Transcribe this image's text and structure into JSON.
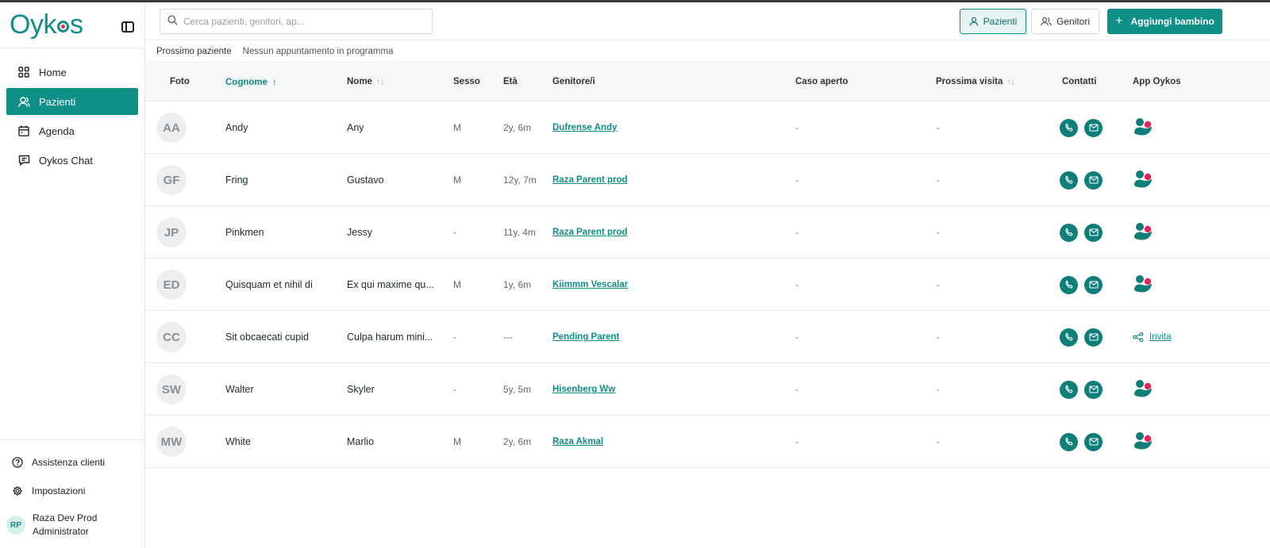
{
  "app": {
    "logo_pre": "Oyk",
    "logo_post": "s"
  },
  "sidebar": {
    "items": [
      {
        "label": "Home",
        "icon": "grid-icon"
      },
      {
        "label": "Pazienti",
        "icon": "user-icon",
        "active": true
      },
      {
        "label": "Agenda",
        "icon": "calendar-icon"
      },
      {
        "label": "Oykos Chat",
        "icon": "chat-icon"
      }
    ],
    "bottom": [
      {
        "label": "Assistenza clienti",
        "icon": "help-icon"
      },
      {
        "label": "Impostazioni",
        "icon": "gear-icon"
      }
    ],
    "user": {
      "initials": "RP",
      "name": "Raza Dev Prod",
      "role": "Administrator"
    }
  },
  "header": {
    "search_placeholder": "Cerca pazienti, genitori, ap...",
    "btn_pazienti": "Pazienti",
    "btn_genitori": "Genitori",
    "btn_add": "Aggiungi bambino"
  },
  "subbar": {
    "label": "Prossimo paziente",
    "value": "Nessun appuntamento in programma"
  },
  "table": {
    "columns": {
      "foto": "Foto",
      "cognome": "Cognome",
      "nome": "Nome",
      "sesso": "Sesso",
      "eta": "Età",
      "genitori": "Genitore/i",
      "caso": "Caso aperto",
      "visita": "Prossima visita",
      "contatti": "Contatti",
      "app": "App Oykos"
    },
    "rows": [
      {
        "initials": "AA",
        "cognome": "Andy",
        "nome": "Any",
        "sesso": "M",
        "eta": "2y, 6m",
        "genitore": "Dufrense Andy",
        "caso": "-",
        "visita": "-",
        "app": "oykos-app-icon"
      },
      {
        "initials": "GF",
        "cognome": "Fring",
        "nome": "Gustavo",
        "sesso": "M",
        "eta": "12y, 7m",
        "genitore": "Raza Parent prod",
        "caso": "-",
        "visita": "-",
        "app": "oykos-app-icon"
      },
      {
        "initials": "JP",
        "cognome": "Pinkmen",
        "nome": "Jessy",
        "sesso": "-",
        "eta": "11y, 4m",
        "genitore": "Raza Parent prod",
        "caso": "-",
        "visita": "-",
        "app": "oykos-app-icon"
      },
      {
        "initials": "ED",
        "cognome": "Quisquam et nihil di",
        "nome": "Ex qui maxime qu...",
        "sesso": "M",
        "eta": "1y, 6m",
        "genitore": "Kiimmm Vescalar",
        "caso": "-",
        "visita": "-",
        "app": "oykos-app-icon"
      },
      {
        "initials": "CC",
        "cognome": "Sit obcaecati cupid",
        "nome": "Culpa harum mini...",
        "sesso": "-",
        "eta": "---",
        "genitore": "Pending Parent",
        "caso": "-",
        "visita": "-",
        "app": "invite",
        "invite_label": "Invita"
      },
      {
        "initials": "SW",
        "cognome": "Walter",
        "nome": "Skyler",
        "sesso": "-",
        "eta": "5y, 5m",
        "genitore": "Hisenberg Ww",
        "caso": "-",
        "visita": "-",
        "app": "oykos-app-icon"
      },
      {
        "initials": "MW",
        "cognome": "White",
        "nome": "Marlio",
        "sesso": "M",
        "eta": "2y, 6m",
        "genitore": "Raza Akmal",
        "caso": "-",
        "visita": "-",
        "app": "oykos-app-icon"
      }
    ]
  },
  "colors": {
    "accent": "#0e8f88",
    "brand_dot": "#e8255b"
  }
}
